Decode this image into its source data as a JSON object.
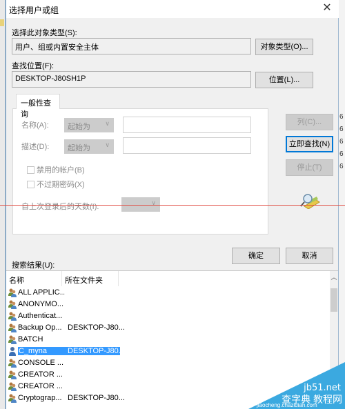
{
  "dialog": {
    "title": "选择用户或组",
    "close_glyph": "✕"
  },
  "object_type": {
    "label": "选择此对象类型(S):",
    "value": "用户、组或内置安全主体",
    "button": "对象类型(O)..."
  },
  "location": {
    "label": "查找位置(F):",
    "value": "DESKTOP-J80SH1P",
    "button": "位置(L)..."
  },
  "query": {
    "tab_label": "一般性查询",
    "name_label": "名称(A):",
    "name_mode": "起始为",
    "name_value": "",
    "desc_label": "描述(D):",
    "desc_mode": "起始为",
    "desc_value": "",
    "disabled_accounts": {
      "label": "禁用的帐户(B)",
      "checked": false
    },
    "non_expiring_pw": {
      "label": "不过期密码(X)",
      "checked": false
    },
    "days_since_logon_label": "自上次登录后的天数(I):",
    "days_since_logon_value": ""
  },
  "side_buttons": {
    "columns": "列(C)...",
    "find_now": "立即查找(N)",
    "stop": "停止(T)"
  },
  "footer": {
    "ok": "确定",
    "cancel": "取消"
  },
  "results": {
    "label": "搜索结果(U):",
    "columns": [
      "名称",
      "所在文件夹"
    ],
    "rows": [
      {
        "name": "ALL APPLIC...",
        "folder": "",
        "icon": "group-icon",
        "selected": false
      },
      {
        "name": "ANONYMO...",
        "folder": "",
        "icon": "group-icon",
        "selected": false
      },
      {
        "name": "Authenticat...",
        "folder": "",
        "icon": "group-icon",
        "selected": false
      },
      {
        "name": "Backup Op...",
        "folder": "DESKTOP-J80...",
        "icon": "group-icon",
        "selected": false
      },
      {
        "name": "BATCH",
        "folder": "",
        "icon": "group-icon",
        "selected": false
      },
      {
        "name": "C_myna",
        "folder": "DESKTOP-J80...",
        "icon": "user-icon",
        "selected": true
      },
      {
        "name": "CONSOLE ...",
        "folder": "",
        "icon": "group-icon",
        "selected": false
      },
      {
        "name": "CREATOR ...",
        "folder": "",
        "icon": "group-icon",
        "selected": false
      },
      {
        "name": "CREATOR ...",
        "folder": "",
        "icon": "group-icon",
        "selected": false
      },
      {
        "name": "Cryptograp...",
        "folder": "DESKTOP-J80...",
        "icon": "group-icon",
        "selected": false
      }
    ]
  },
  "watermark": {
    "line1": "jb51.net",
    "line2": "查字典 教程网",
    "line3": "jiaocheng.chazidian.com"
  },
  "colors": {
    "accent": "#0078d7",
    "selection": "#3399ff",
    "annotation_line": "#e04a40",
    "watermark": "#3ba9e0"
  }
}
